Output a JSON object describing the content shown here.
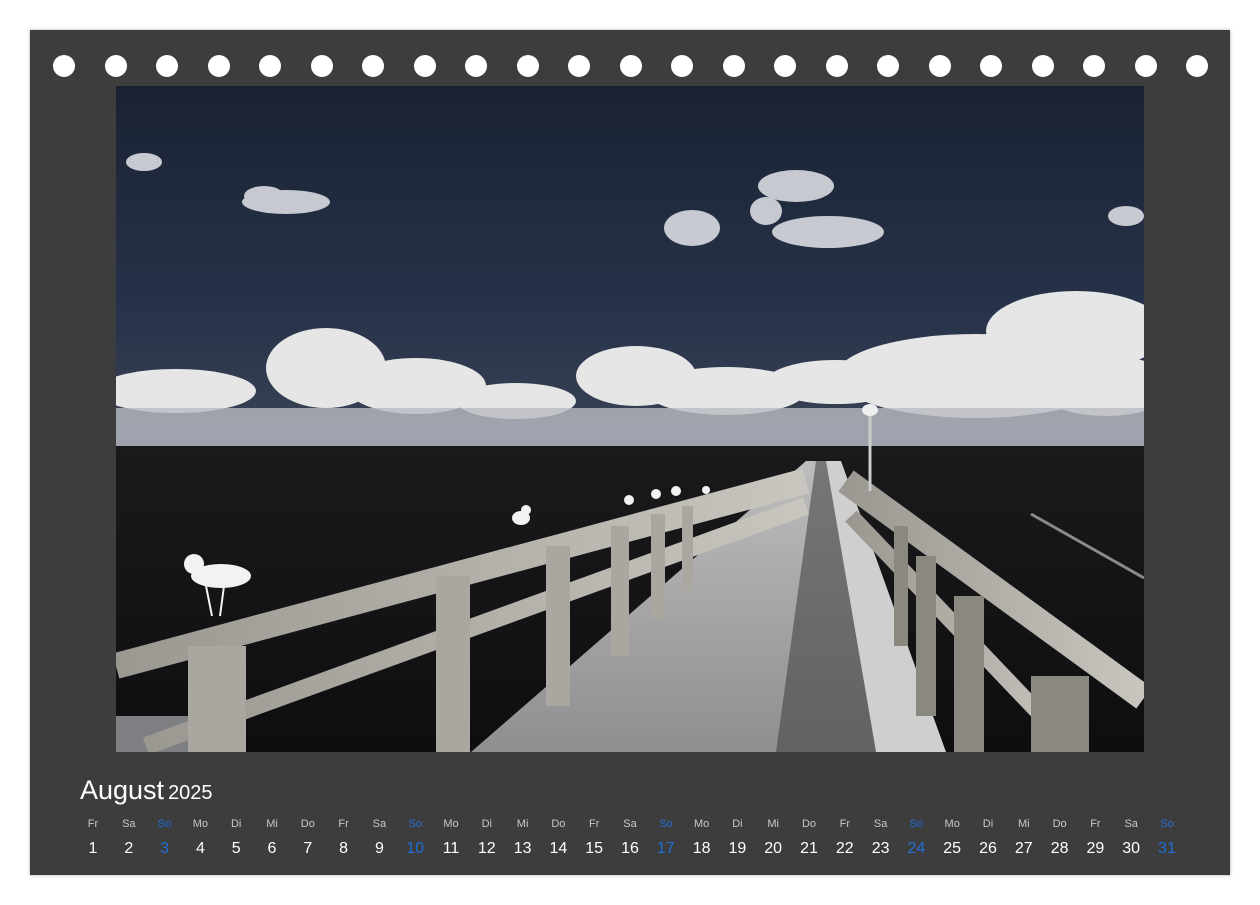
{
  "calendar": {
    "month": "August",
    "year": "2025",
    "sunday_color": "#1f6fd6",
    "days": [
      {
        "wd": "Fr",
        "n": "1"
      },
      {
        "wd": "Sa",
        "n": "2"
      },
      {
        "wd": "So",
        "n": "3"
      },
      {
        "wd": "Mo",
        "n": "4"
      },
      {
        "wd": "Di",
        "n": "5"
      },
      {
        "wd": "Mi",
        "n": "6"
      },
      {
        "wd": "Do",
        "n": "7"
      },
      {
        "wd": "Fr",
        "n": "8"
      },
      {
        "wd": "Sa",
        "n": "9"
      },
      {
        "wd": "So",
        "n": "10"
      },
      {
        "wd": "Mo",
        "n": "11"
      },
      {
        "wd": "Di",
        "n": "12"
      },
      {
        "wd": "Mi",
        "n": "13"
      },
      {
        "wd": "Do",
        "n": "14"
      },
      {
        "wd": "Fr",
        "n": "15"
      },
      {
        "wd": "Sa",
        "n": "16"
      },
      {
        "wd": "So",
        "n": "17"
      },
      {
        "wd": "Mo",
        "n": "18"
      },
      {
        "wd": "Di",
        "n": "19"
      },
      {
        "wd": "Mi",
        "n": "20"
      },
      {
        "wd": "Do",
        "n": "21"
      },
      {
        "wd": "Fr",
        "n": "22"
      },
      {
        "wd": "Sa",
        "n": "23"
      },
      {
        "wd": "So",
        "n": "24"
      },
      {
        "wd": "Mo",
        "n": "25"
      },
      {
        "wd": "Di",
        "n": "26"
      },
      {
        "wd": "Mi",
        "n": "27"
      },
      {
        "wd": "Do",
        "n": "28"
      },
      {
        "wd": "Fr",
        "n": "29"
      },
      {
        "wd": "Sa",
        "n": "30"
      },
      {
        "wd": "So",
        "n": "31"
      }
    ]
  },
  "binding": {
    "hole_count": 23
  }
}
